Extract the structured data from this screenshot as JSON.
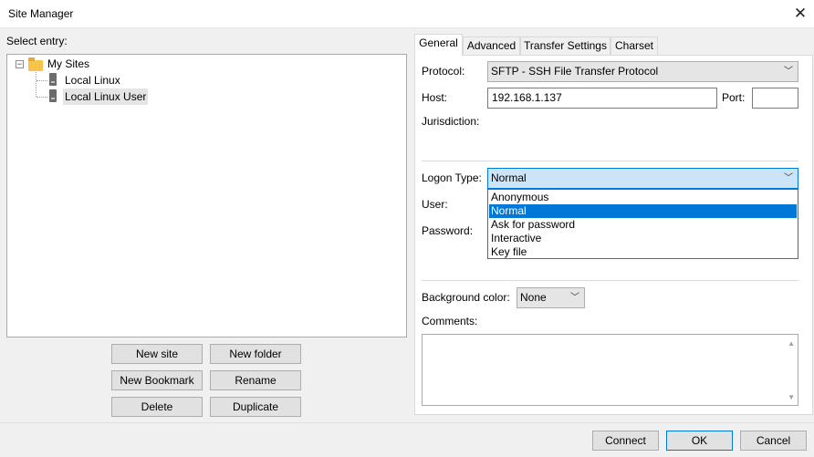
{
  "window": {
    "title": "Site Manager",
    "close_glyph": "✕"
  },
  "left": {
    "select_entry_label": "Select entry:",
    "tree": {
      "root": {
        "label": "My Sites",
        "expander": "−"
      },
      "children": [
        {
          "label": "Local Linux"
        },
        {
          "label": "Local Linux User"
        }
      ]
    },
    "buttons": {
      "new_site": "New site",
      "new_folder": "New folder",
      "new_bookmark": "New Bookmark",
      "rename": "Rename",
      "delete": "Delete",
      "duplicate": "Duplicate"
    }
  },
  "tabs": [
    "General",
    "Advanced",
    "Transfer Settings",
    "Charset"
  ],
  "general": {
    "protocol_label": "Protocol:",
    "protocol_value": "SFTP - SSH File Transfer Protocol",
    "host_label": "Host:",
    "host_value": "192.168.1.137",
    "port_label": "Port:",
    "port_value": "",
    "jurisdiction_label": "Jurisdiction:",
    "logon_type_label": "Logon Type:",
    "logon_type_value": "Normal",
    "logon_options": [
      "Anonymous",
      "Normal",
      "Ask for password",
      "Interactive",
      "Key file"
    ],
    "user_label": "User:",
    "password_label": "Password:",
    "background_color_label": "Background color:",
    "background_color_value": "None",
    "comments_label": "Comments:"
  },
  "footer": {
    "connect": "Connect",
    "ok": "OK",
    "cancel": "Cancel"
  },
  "colors": {
    "selection": "#0078d7",
    "focus_fill": "#cce4f7",
    "folder": "#f7c34b"
  }
}
